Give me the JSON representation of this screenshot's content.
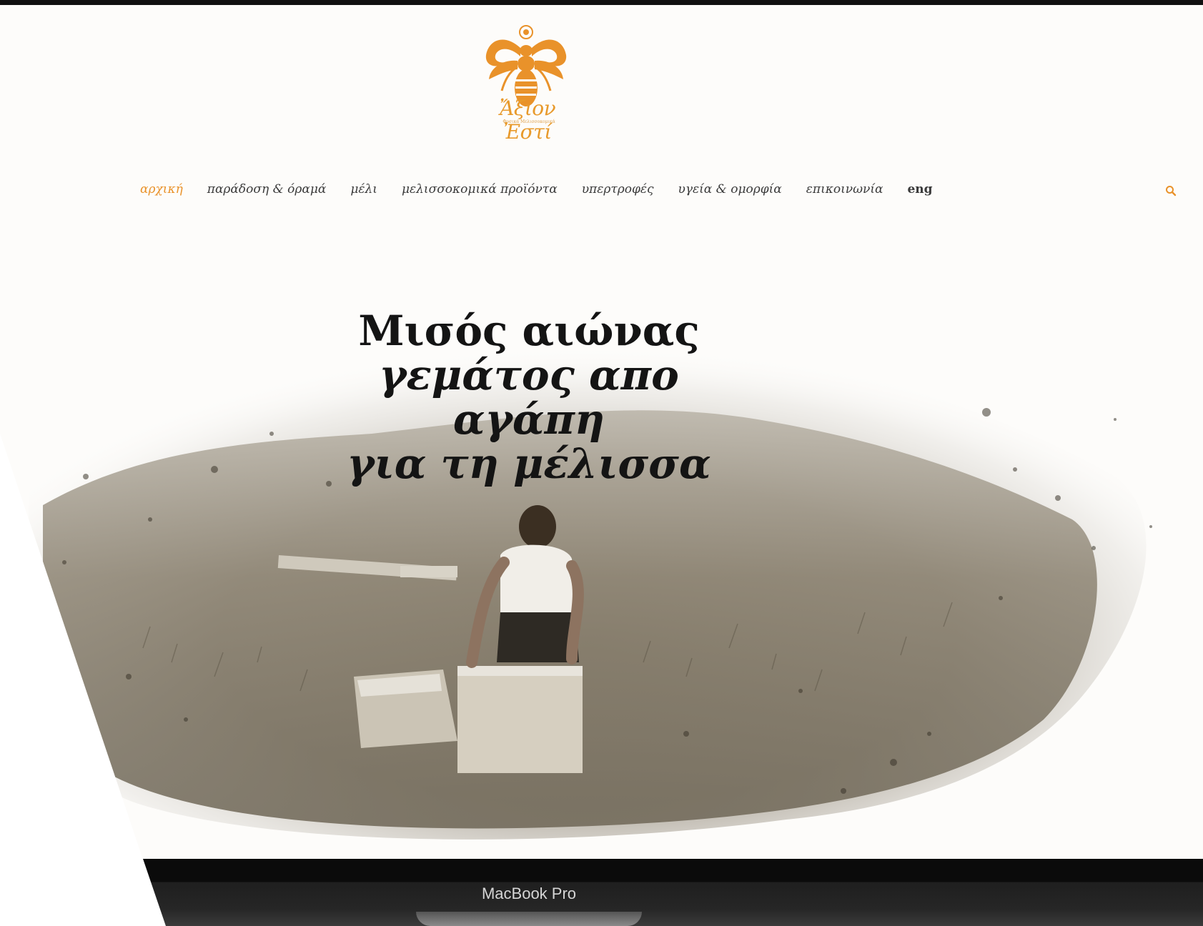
{
  "logo": {
    "script_text": "Ἄξιον Ἐστί",
    "sub_text": "Φυσικά Μελισσοκομικά",
    "icon": "bee-emblem-icon",
    "color": "#E9922A"
  },
  "nav": {
    "items": [
      {
        "label": "αρχική",
        "active": true
      },
      {
        "label": "παράδοση & όραμά"
      },
      {
        "label": "μέλι"
      },
      {
        "label": "μελισσοκομικά προϊόντα"
      },
      {
        "label": "υπερτροφές"
      },
      {
        "label": "υγεία & ομορφία"
      },
      {
        "label": "επικοινωνία"
      },
      {
        "label": "eng"
      }
    ],
    "search_icon": "search-icon",
    "accent_color": "#E9922A"
  },
  "hero": {
    "headline_line1": "Μισός αιώνας",
    "headline_line2": "γεμάτος απο αγάπη",
    "headline_line3": "για τη μέλισσα",
    "image": "vintage-beekeeper-photo"
  },
  "device": {
    "label": "MacBook Pro"
  }
}
